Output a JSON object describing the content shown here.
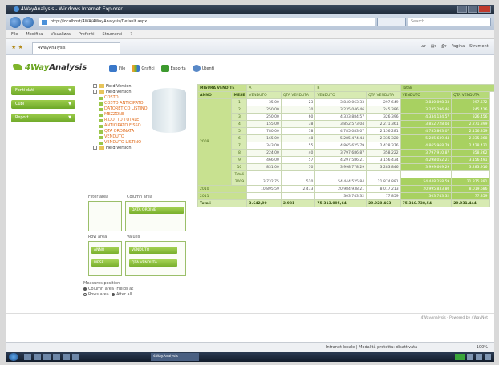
{
  "browser": {
    "title": "4WayAnalysis - Windows Internet Explorer",
    "url": "http://localhost/4WA/4WayAnalysis/Default.aspx",
    "search_placeholder": "Search",
    "menu": [
      "File",
      "Modifica",
      "Visualizza",
      "Preferiti",
      "Strumenti",
      "?"
    ],
    "tab_label": "4WayAnalysis",
    "tools": [
      "Pagina",
      "Strumenti"
    ]
  },
  "app": {
    "logo": {
      "prefix": "4Way",
      "suffix": "Analysis"
    },
    "toolbar": [
      {
        "icon": "file-icon",
        "label": "File"
      },
      {
        "icon": "chart-icon",
        "label": "Grafici"
      },
      {
        "icon": "export-icon",
        "label": "Esporta"
      },
      {
        "icon": "users-icon",
        "label": "Utenti"
      }
    ],
    "sidebar": [
      "Fonti dati",
      "Cubi",
      "Report"
    ],
    "tree": {
      "root1": "Field Version",
      "root2": "Field Version",
      "leaves": [
        "COSTO",
        "COSTO ANTICIPATO",
        "DATORETICO LISTINO",
        "MEZZONE",
        "RIDOTTO TOTALE",
        "ANTICIPATO FISSO",
        "QTA ORDINATA",
        "VENDUTO",
        "VENDUTO LISTINO"
      ],
      "more": "Field Version"
    },
    "areas": {
      "filter_label": "Filter area",
      "column_label": "Column area",
      "row_label": "Row area",
      "values_label": "Values",
      "column_chip": "DATA ORDINE",
      "row_chips": [
        "ANNO",
        "MESE"
      ],
      "value_chips": [
        "VENDUTO",
        "QTA VENDUTA"
      ]
    },
    "measure": {
      "title": "Measures position",
      "options": [
        "Column area (Fields at",
        "Rows area",
        "After all"
      ]
    },
    "pivot": {
      "corner_top": "MISURA VENDITE",
      "corner_bottom": [
        "ANNO",
        "MESE"
      ],
      "col_groups": [
        "A",
        "B",
        "Totali"
      ],
      "measures": [
        "VENDUTO",
        "QTA VENDUTA"
      ],
      "year_main": "2009",
      "months": [
        "1",
        "2",
        "3",
        "4",
        "5",
        "6",
        "7",
        "8",
        "9",
        "10"
      ],
      "rows": [
        [
          "35,00",
          "23",
          "3.840.063,33",
          "297.649",
          "3.840.098,33",
          "297.672"
        ],
        [
          "250,00",
          "30",
          "3.235.046,46",
          "245.386",
          "3.235.296,46",
          "245.416"
        ],
        [
          "250,00",
          "60",
          "4.333.884,57",
          "326.396",
          "4.334.134,57",
          "326.456"
        ],
        [
          "155,00",
          "38",
          "3.852.573,04",
          "2.271.361",
          "3.852.728,04",
          "2.271.399"
        ],
        [
          "780,00",
          "78",
          "4.785.083,07",
          "2.156.281",
          "4.785.863,07",
          "2.156.359"
        ],
        [
          "165,00",
          "48",
          "5.285.474,44",
          "2.335.320",
          "5.285.639,44",
          "2.335.368"
        ],
        [
          "343,00",
          "55",
          "4.865.625,79",
          "2.428.376",
          "4.865.968,79",
          "2.428.431"
        ],
        [
          "224,00",
          "40",
          "3.797.686,87",
          "358.222",
          "3.797.910,87",
          "358.262"
        ],
        [
          "466,00",
          "57",
          "4.297.586,21",
          "3.156.434",
          "4.298.052,21",
          "3.156.491"
        ],
        [
          "831,00",
          "70",
          "3.998.778,29",
          "3.283.846",
          "3.999.609,29",
          "3.283.916"
        ]
      ],
      "subtotal_label": "Totali",
      "subtotal_year": "2009",
      "subtotal": [
        "3.732,75",
        "510",
        "54.444.525,84",
        "21.874.881",
        "54.448.258,59",
        "21.875.391"
      ],
      "year_rows": [
        {
          "label": "2010",
          "values": [
            "10.895,59",
            "2.473",
            "20.984.938,21",
            "8.017.213",
            "20.995.833,80",
            "8.019.686"
          ]
        },
        {
          "label": "2011",
          "values": [
            "",
            "",
            "303.743,32",
            "77.859",
            "303.743,32",
            "77.859"
          ]
        }
      ],
      "total_label": "Totali",
      "total": [
        "3.642,90",
        "2.981",
        "75.313.095,64",
        "29.928.463",
        "75.316.738,54",
        "29.931.444"
      ]
    },
    "footer": "4WayAnalysis - Powered by 4WayNet"
  },
  "status": {
    "zone": "Intranet locale | Modalità protetta: disattivata",
    "zoom": "100%"
  },
  "taskbar": {
    "window": "4WayAnalysis"
  }
}
